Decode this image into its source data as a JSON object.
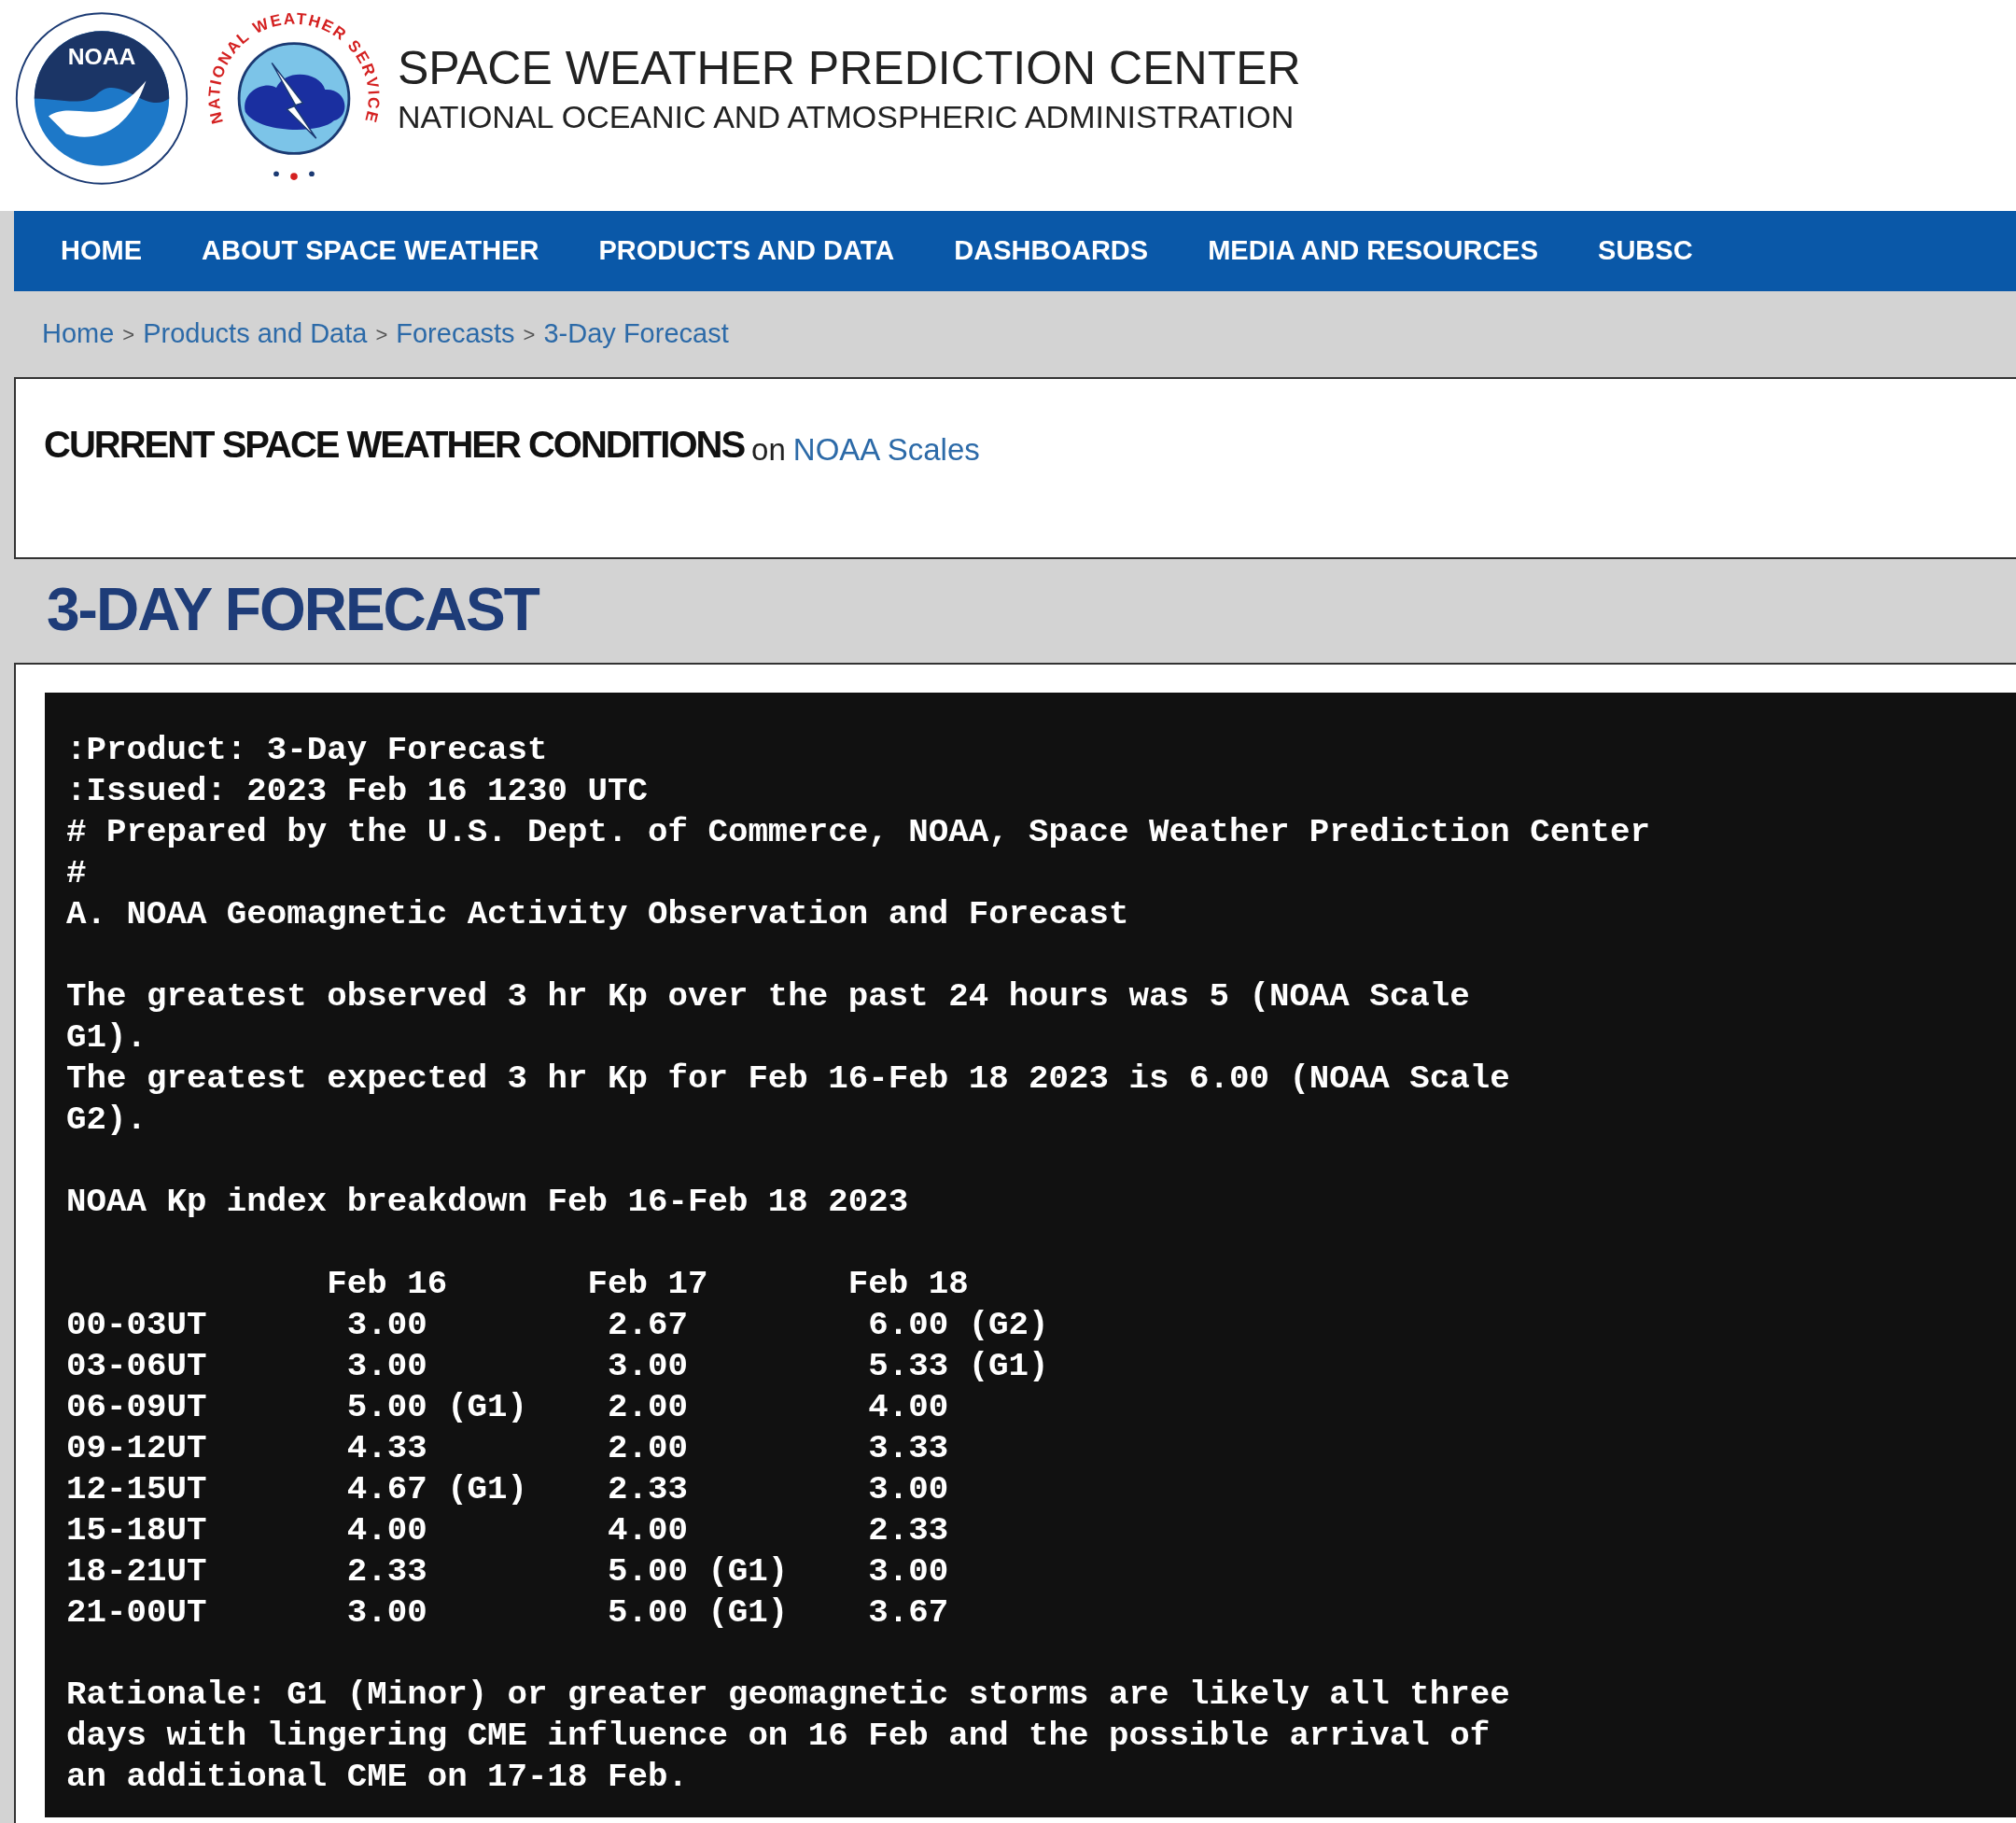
{
  "header": {
    "logos": [
      {
        "kind": "noaa",
        "text": "NOAA"
      },
      {
        "kind": "nws",
        "text": "NATIONAL WEATHER SERVICE"
      }
    ],
    "title": "SPACE WEATHER PREDICTION CENTER",
    "subtitle": "NATIONAL OCEANIC AND ATMOSPHERIC ADMINISTRATION"
  },
  "nav": [
    {
      "label": "HOME"
    },
    {
      "label": "ABOUT SPACE WEATHER"
    },
    {
      "label": "PRODUCTS AND DATA"
    },
    {
      "label": "DASHBOARDS"
    },
    {
      "label": "MEDIA AND RESOURCES"
    },
    {
      "label": "SUBSC"
    }
  ],
  "breadcrumb": [
    {
      "kind": "link",
      "text": "Home"
    },
    {
      "kind": "separator",
      "text": ">"
    },
    {
      "kind": "link",
      "text": "Products and Data"
    },
    {
      "kind": "separator",
      "text": ">"
    },
    {
      "kind": "link",
      "text": "Forecasts"
    },
    {
      "kind": "separator",
      "text": ">"
    },
    {
      "kind": "link",
      "text": "3-Day Forecast"
    }
  ],
  "conditions": {
    "title": "CURRENT SPACE WEATHER CONDITIONS",
    "connector": "on",
    "link": "NOAA Scales"
  },
  "heading": "3-DAY FORECAST",
  "forecast": {
    "blocks": [
      {
        "kind": "lines",
        "lines": [
          ":Product: 3-Day Forecast",
          ":Issued: 2023 Feb 16 1230 UTC",
          "# Prepared by the U.S. Dept. of Commerce, NOAA, Space Weather Prediction Center",
          "#",
          "A. NOAA Geomagnetic Activity Observation and Forecast"
        ]
      },
      {
        "kind": "lines",
        "lines": [
          "The greatest observed 3 hr Kp over the past 24 hours was 5 (NOAA Scale",
          "G1).",
          "The greatest expected 3 hr Kp for Feb 16-Feb 18 2023 is 6.00 (NOAA Scale",
          "G2)."
        ]
      },
      {
        "kind": "lines",
        "lines": [
          "NOAA Kp index breakdown Feb 16-Feb 18 2023"
        ]
      },
      {
        "kind": "table",
        "columns": [
          "Feb 16",
          "Feb 17",
          "Feb 18"
        ],
        "rows": [
          {
            "period": "00-03UT",
            "values": [
              "3.00",
              "2.67",
              "6.00 (G2)"
            ]
          },
          {
            "period": "03-06UT",
            "values": [
              "3.00",
              "3.00",
              "5.33 (G1)"
            ]
          },
          {
            "period": "06-09UT",
            "values": [
              "5.00 (G1)",
              "2.00",
              "4.00"
            ]
          },
          {
            "period": "09-12UT",
            "values": [
              "4.33",
              "2.00",
              "3.33"
            ]
          },
          {
            "period": "12-15UT",
            "values": [
              "4.67 (G1)",
              "2.33",
              "3.00"
            ]
          },
          {
            "period": "15-18UT",
            "values": [
              "4.00",
              "4.00",
              "2.33"
            ]
          },
          {
            "period": "18-21UT",
            "values": [
              "2.33",
              "5.00 (G1)",
              "3.00"
            ]
          },
          {
            "period": "21-00UT",
            "values": [
              "3.00",
              "5.00 (G1)",
              "3.67"
            ]
          }
        ]
      },
      {
        "kind": "lines",
        "lines": [
          "Rationale: G1 (Minor) or greater geomagnetic storms are likely all three",
          "days with lingering CME influence on 16 Feb and the possible arrival of",
          "an additional CME on 17-18 Feb."
        ]
      }
    ]
  }
}
